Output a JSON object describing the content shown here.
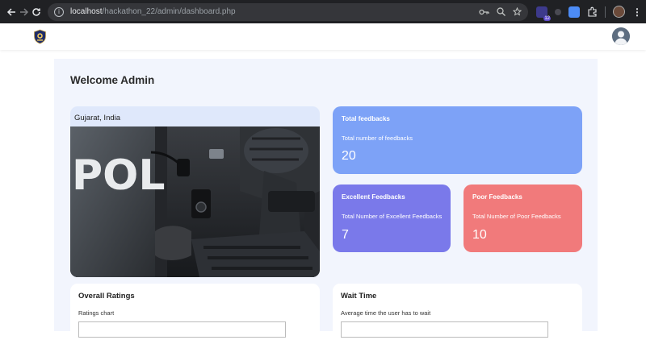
{
  "browser": {
    "url_host": "localhost",
    "url_path": "/hackathon_22/admin/dashboard.php",
    "extension_badge": "12"
  },
  "welcome": "Welcome Admin",
  "location": {
    "label": "Gujarat, India",
    "image_text": "POLIC"
  },
  "stats": {
    "total": {
      "title": "Total feedbacks",
      "subtitle": "Total number of feedbacks",
      "value": "20"
    },
    "excellent": {
      "title": "Excellent Feedbacks",
      "subtitle": "Total Number of Excellent Feedbacks",
      "value": "7"
    },
    "poor": {
      "title": "Poor Feedbacks",
      "subtitle": "Total Number of Poor Feedbacks",
      "value": "10"
    }
  },
  "panels": {
    "ratings": {
      "title": "Overall Ratings",
      "subtitle": "Ratings chart"
    },
    "wait": {
      "title": "Wait Time",
      "subtitle": "Average time the user has to wait"
    }
  },
  "colors": {
    "total": "#7da2f7",
    "excellent": "#7a79ea",
    "poor": "#f17a7b",
    "page_bg": "#f2f5fd",
    "location_card": "#dfe8fb"
  }
}
